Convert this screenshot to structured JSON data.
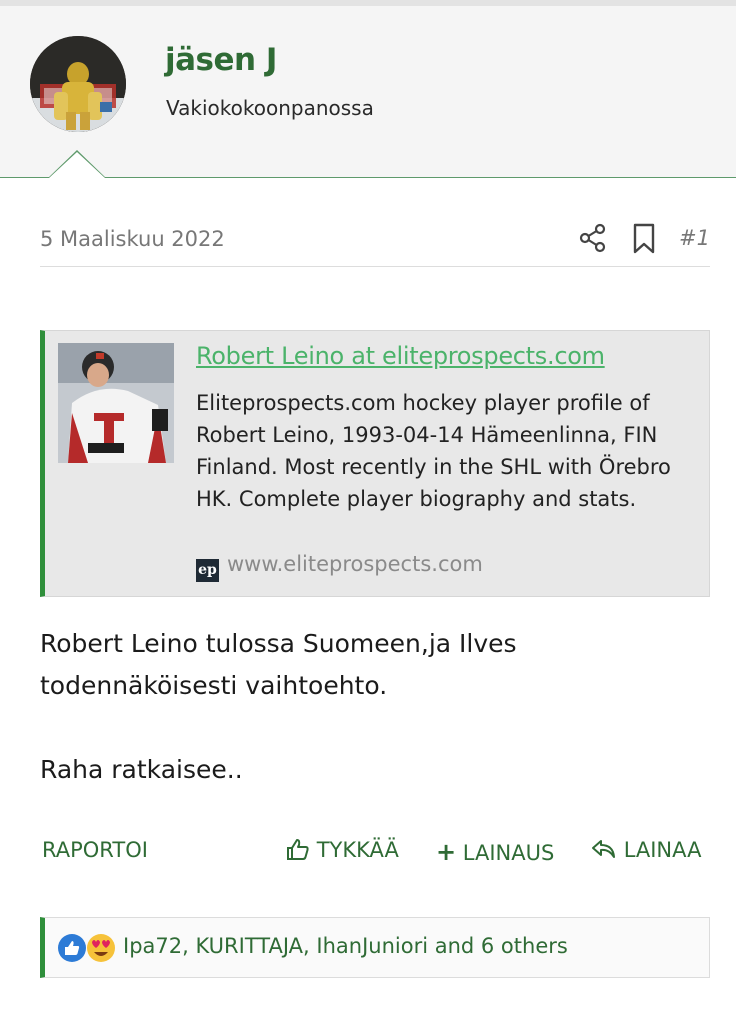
{
  "user": {
    "name": "jäsen J",
    "title": "Vakiokokoonpanossa",
    "avatar_icon": "goalie-photo-icon"
  },
  "post": {
    "date": "5 Maaliskuu 2022",
    "number": "#1",
    "icons": [
      "share-icon",
      "bookmark-icon"
    ]
  },
  "unfurl": {
    "title": "Robert Leino at eliteprospects.com",
    "description": "Eliteprospects.com hockey player profile of Robert Leino, 1993-04-14 Hämeenlinna, FIN Finland. Most recently in the SHL with Örebro HK. Complete player biography and stats.",
    "favicon_text": "ep",
    "site": "www.eliteprospects.com"
  },
  "body": {
    "line1": "Robert Leino tulossa Suomeen,ja Ilves todennäköisesti vaihtoehto.",
    "line2": "Raha ratkaisee.."
  },
  "actions": {
    "report": "RAPORTOI",
    "like": "TYKKÄÄ",
    "multiquote": "LAINAUS",
    "quote": "LAINAA",
    "like_icon": "thumbs-up-icon",
    "multiquote_icon": "plus-icon",
    "quote_icon": "reply-icon"
  },
  "reactions": {
    "text": "Ipa72, KURITTAJA, IhanJuniori and 6 others",
    "icons": [
      "like-reaction-icon",
      "love-reaction-icon"
    ]
  },
  "colors": {
    "accent_green": "#2f6b35",
    "link_green": "#4bb36a",
    "border_green": "#2f8f3b"
  }
}
